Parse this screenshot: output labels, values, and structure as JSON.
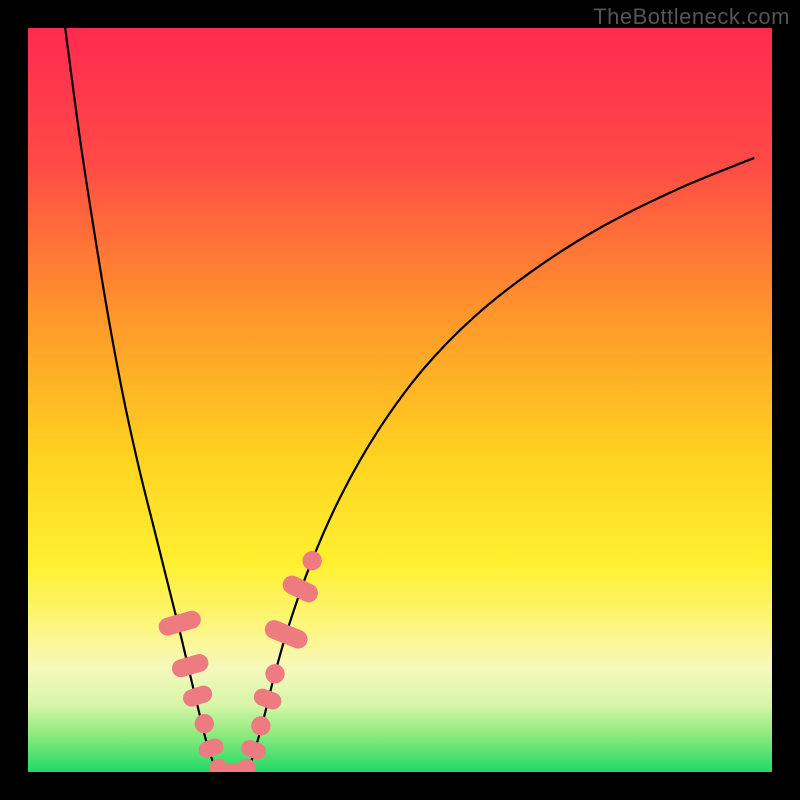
{
  "watermark": "TheBottleneck.com",
  "chart_data": {
    "type": "line",
    "title": "",
    "xlabel": "",
    "ylabel": "",
    "xlim": [
      0,
      100
    ],
    "ylim": [
      0,
      100
    ],
    "gradient_stops": [
      {
        "offset": 0,
        "color": "#ff2a4f"
      },
      {
        "offset": 0.18,
        "color": "#ff4a46"
      },
      {
        "offset": 0.4,
        "color": "#ff9b2a"
      },
      {
        "offset": 0.58,
        "color": "#ffd420"
      },
      {
        "offset": 0.72,
        "color": "#fff030"
      },
      {
        "offset": 0.8,
        "color": "#fdf57a"
      },
      {
        "offset": 0.86,
        "color": "#f6f8bc"
      },
      {
        "offset": 0.91,
        "color": "#d6f6a8"
      },
      {
        "offset": 0.95,
        "color": "#8ceb7d"
      },
      {
        "offset": 1.0,
        "color": "#1fd968"
      }
    ],
    "series": [
      {
        "name": "left-curve",
        "points": [
          {
            "x": 5.0,
            "y": 100.0
          },
          {
            "x": 7.0,
            "y": 85.0
          },
          {
            "x": 9.0,
            "y": 72.0
          },
          {
            "x": 11.0,
            "y": 60.0
          },
          {
            "x": 13.0,
            "y": 49.5
          },
          {
            "x": 15.0,
            "y": 40.5
          },
          {
            "x": 17.0,
            "y": 32.5
          },
          {
            "x": 19.0,
            "y": 24.5
          },
          {
            "x": 20.5,
            "y": 18.5
          },
          {
            "x": 21.8,
            "y": 13.0
          },
          {
            "x": 23.0,
            "y": 8.0
          },
          {
            "x": 24.0,
            "y": 4.0
          },
          {
            "x": 25.0,
            "y": 1.0
          },
          {
            "x": 25.6,
            "y": 0.0
          }
        ]
      },
      {
        "name": "bottom-flat",
        "points": [
          {
            "x": 25.6,
            "y": 0.0
          },
          {
            "x": 29.4,
            "y": 0.0
          }
        ]
      },
      {
        "name": "right-curve",
        "points": [
          {
            "x": 29.4,
            "y": 0.0
          },
          {
            "x": 30.2,
            "y": 2.0
          },
          {
            "x": 31.5,
            "y": 6.5
          },
          {
            "x": 33.0,
            "y": 12.5
          },
          {
            "x": 35.0,
            "y": 19.5
          },
          {
            "x": 38.0,
            "y": 28.0
          },
          {
            "x": 42.0,
            "y": 37.0
          },
          {
            "x": 47.0,
            "y": 45.8
          },
          {
            "x": 53.0,
            "y": 54.0
          },
          {
            "x": 60.0,
            "y": 61.2
          },
          {
            "x": 68.0,
            "y": 67.5
          },
          {
            "x": 77.0,
            "y": 73.2
          },
          {
            "x": 87.0,
            "y": 78.2
          },
          {
            "x": 97.5,
            "y": 82.5
          }
        ]
      }
    ],
    "markers": [
      {
        "shape": "pill",
        "cx": 20.4,
        "cy": 20.0,
        "w": 2.4,
        "h": 5.8,
        "angle": -74
      },
      {
        "shape": "pill",
        "cx": 21.8,
        "cy": 14.3,
        "w": 2.4,
        "h": 5.0,
        "angle": -74
      },
      {
        "shape": "pill",
        "cx": 22.8,
        "cy": 10.2,
        "w": 2.3,
        "h": 4.0,
        "angle": -72
      },
      {
        "shape": "circle",
        "cx": 23.7,
        "cy": 6.5,
        "r": 1.3
      },
      {
        "shape": "pill",
        "cx": 24.6,
        "cy": 3.2,
        "w": 2.2,
        "h": 3.4,
        "angle": -70
      },
      {
        "shape": "circle",
        "cx": 25.6,
        "cy": 0.6,
        "r": 1.2
      },
      {
        "shape": "pill",
        "cx": 27.5,
        "cy": 0.0,
        "w": 3.8,
        "h": 2.2,
        "angle": 0
      },
      {
        "shape": "circle",
        "cx": 29.4,
        "cy": 0.6,
        "r": 1.2
      },
      {
        "shape": "pill",
        "cx": 30.3,
        "cy": 3.0,
        "w": 2.2,
        "h": 3.4,
        "angle": 70
      },
      {
        "shape": "circle",
        "cx": 31.3,
        "cy": 6.2,
        "r": 1.3
      },
      {
        "shape": "pill",
        "cx": 32.2,
        "cy": 9.8,
        "w": 2.3,
        "h": 3.8,
        "angle": 70
      },
      {
        "shape": "circle",
        "cx": 33.2,
        "cy": 13.2,
        "r": 1.3
      },
      {
        "shape": "pill",
        "cx": 34.7,
        "cy": 18.5,
        "w": 2.5,
        "h": 6.0,
        "angle": 68
      },
      {
        "shape": "pill",
        "cx": 36.6,
        "cy": 24.6,
        "w": 2.5,
        "h": 5.0,
        "angle": 64
      },
      {
        "shape": "circle",
        "cx": 38.2,
        "cy": 28.4,
        "r": 1.3
      }
    ]
  }
}
